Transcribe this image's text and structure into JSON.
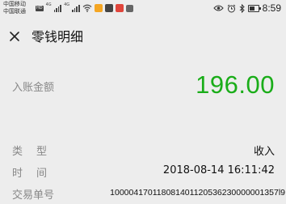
{
  "status_bar": {
    "carrier_1": "中国移动",
    "carrier_2": "中国联通",
    "hd_badge": "HD",
    "net_1": "4G",
    "net_2": "4G",
    "time": "8:59"
  },
  "nav": {
    "title": "零钱明细"
  },
  "amount": {
    "label": "入账金额",
    "value": "196.00",
    "color": "#1aad19"
  },
  "details": {
    "type_label": "类型",
    "type_value": "收入",
    "time_label": "时间",
    "time_value": "2018-08-14 16:11:42",
    "txn_label": "交易单号",
    "txn_value": "100004170118081401120536230000001357l9"
  }
}
